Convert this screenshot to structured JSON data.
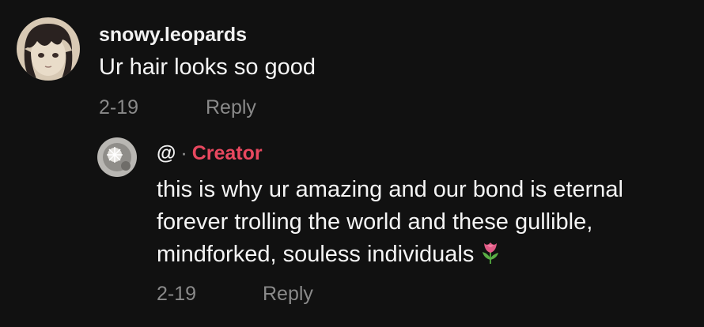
{
  "comment": {
    "username": "snowy.leopards",
    "text": "Ur hair looks so good",
    "date": "2-19",
    "reply_label": "Reply"
  },
  "reply": {
    "handle": "@",
    "separator": "·",
    "creator_label": "Creator",
    "lines": [
      "this is why ur amazing and our bond is eternal",
      "forever trolling the world and these gullible,",
      "mindforked, souless individuals"
    ],
    "emoji": "tulip-emoji",
    "date": "2-19",
    "reply_label": "Reply"
  },
  "colors": {
    "background": "#111111",
    "creator_accent": "#e8485f",
    "meta_gray": "#8a8a8a"
  }
}
